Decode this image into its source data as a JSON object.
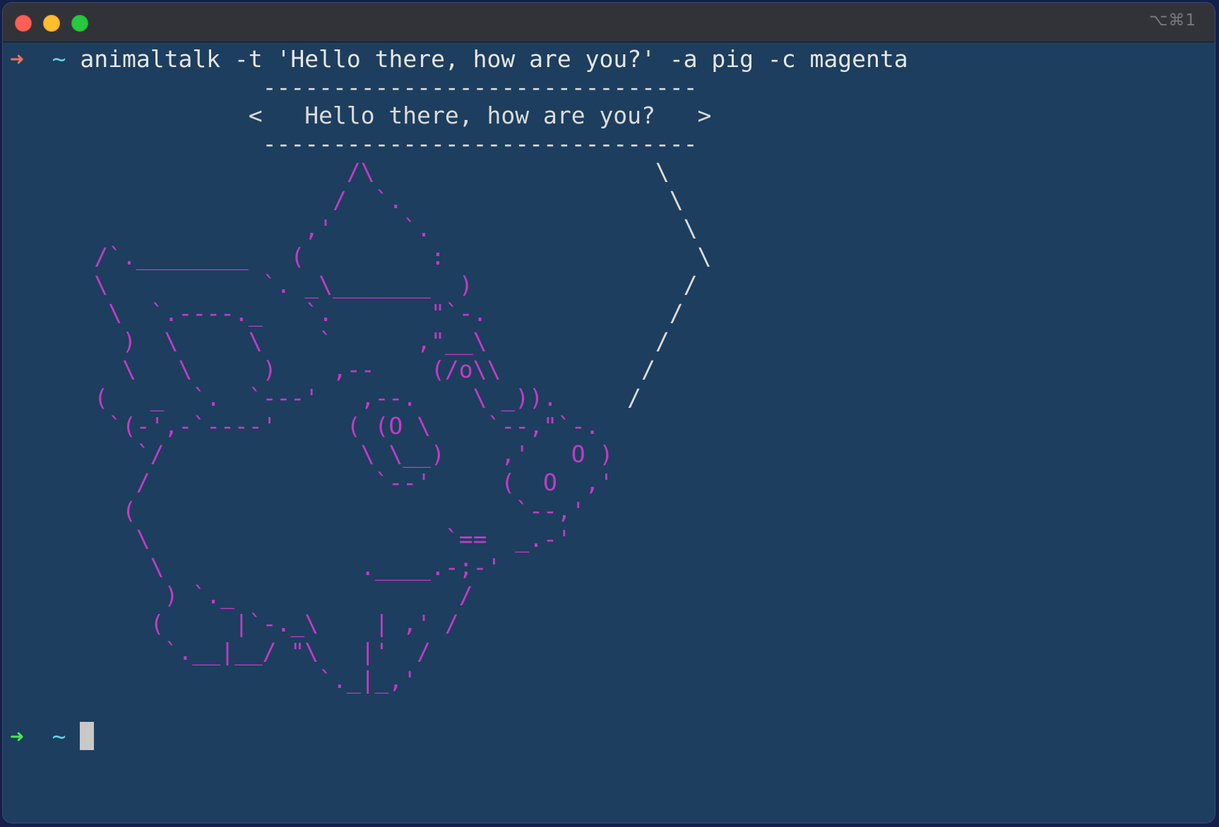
{
  "window": {
    "shortcut": "⌥⌘1"
  },
  "prompt": {
    "arrow": "➜",
    "dir": "~"
  },
  "command": "animaltalk -t 'Hello there, how are you?' -a pig -c magenta",
  "bubble": {
    "top": "                  -------------------------------",
    "text": "                 <   Hello there, how are you?   >",
    "bottom": "                  -------------------------------"
  },
  "ascii_art_lines": [
    {
      "pig": "                        /\\",
      "line": "                  \\"
    },
    {
      "pig": "                       /  `.",
      "line": "                  \\"
    },
    {
      "pig": "                     ,'     `.",
      "line": "                  \\"
    },
    {
      "pig": "      /`.________   (         :",
      "line": "                  \\"
    },
    {
      "pig": "      \\           `. _\\_______  )",
      "line": "               /"
    },
    {
      "pig": "       \\  `.----._   `.       \"`-.",
      "line": "               /"
    },
    {
      "pig": "        )  \\     \\    `      ,\"__\\",
      "line": "               /"
    },
    {
      "pig": "        \\   \\     )    ,--    (/o\\\\",
      "line": "               /"
    },
    {
      "pig": "      (   _  `.  `---'   ,--.    \\ _)).",
      "line": "          /"
    },
    {
      "pig": "       `(-',-`----'     ( (O \\    `--,\"`-.",
      "line": ""
    },
    {
      "pig": "         `/              \\ \\__)    ,'   O )",
      "line": ""
    },
    {
      "pig": "         /                `--'     (  O  ,'",
      "line": ""
    },
    {
      "pig": "        (                           `--,'",
      "line": ""
    },
    {
      "pig": "         \\                     `==  _.-'",
      "line": ""
    },
    {
      "pig": "          \\              .____.-;-'",
      "line": ""
    },
    {
      "pig": "           ) `._                /",
      "line": ""
    },
    {
      "pig": "          (     |`-._\\    | ,' /",
      "line": ""
    },
    {
      "pig": "           `.__|__/ \"\\   |'  /",
      "line": ""
    },
    {
      "pig": "                      `._|_,'",
      "line": ""
    }
  ],
  "colors": {
    "background": "#1d3e5e",
    "titlebar": "#323339",
    "prompt_error_arrow": "#f0735d",
    "prompt_ok_arrow": "#4fe35a",
    "tilde": "#60d6e6",
    "magenta": "#c23bc6",
    "text": "#e3e3e3"
  }
}
